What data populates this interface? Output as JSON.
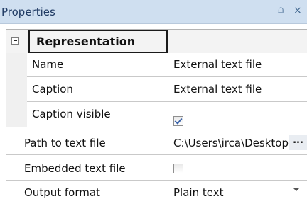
{
  "panel": {
    "title": "Properties",
    "pin_glyph": "⩍",
    "close_glyph": "×"
  },
  "category": {
    "label": "Representation",
    "collapse_icon": "minus-box-icon"
  },
  "properties": [
    {
      "name": "Name",
      "value": "External text file"
    },
    {
      "name": "Caption",
      "value": "External text file"
    },
    {
      "name": "Caption visible",
      "checked": true
    },
    {
      "name": "Path to text file",
      "value": "C:\\Users\\irca\\Desktop\\",
      "button_label": "..."
    },
    {
      "name": "Embedded text file",
      "checked": false
    },
    {
      "name": "Output format",
      "value": "Plain text"
    }
  ],
  "colors": {
    "titlebar_bg": "#cfdff0",
    "checkmark": "#3b63a8",
    "category_bg": "#f3f3f3"
  }
}
